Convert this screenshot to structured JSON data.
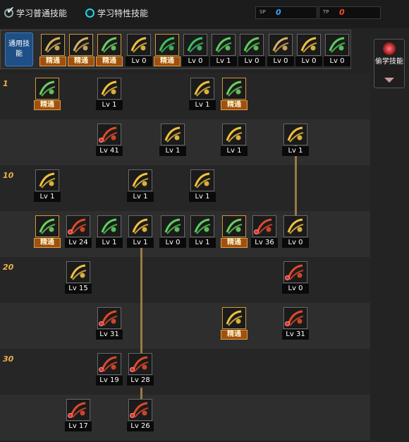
{
  "header": {
    "tab_general": "学习普通技能",
    "tab_special": "学习特性技能",
    "points_sp_label": "SP",
    "points_sp": "0",
    "points_tp_label": "TP",
    "points_tp": "0"
  },
  "general_bar_label": "通用技能",
  "steal_button_label": "偷学技能",
  "level_markers": [
    "1",
    "10",
    "20",
    "30"
  ],
  "general_skills": [
    {
      "level": "精通",
      "mastered": true,
      "color": "#d9b060",
      "icon": "sit-figure-icon"
    },
    {
      "level": "精通",
      "mastered": true,
      "color": "#d9b060",
      "icon": "crouch-figure-icon"
    },
    {
      "level": "精通",
      "mastered": true,
      "color": "#6bd060",
      "icon": "dash-figure-icon"
    },
    {
      "level": "Lv 0",
      "mastered": false,
      "color": "#f0c040",
      "icon": "wings-icon"
    },
    {
      "level": "精通",
      "mastered": true,
      "color": "#40c060",
      "icon": "target-icon"
    },
    {
      "level": "Lv 0",
      "mastered": false,
      "color": "#40c060",
      "icon": "crosshair-icon"
    },
    {
      "level": "Lv 1",
      "mastered": false,
      "color": "#5cd05c",
      "icon": "soldier-icon"
    },
    {
      "level": "Lv 0",
      "mastered": false,
      "color": "#5cd05c",
      "icon": "helmet-icon"
    },
    {
      "level": "Lv 0",
      "mastered": false,
      "color": "#d9b060",
      "icon": "eye-icon"
    },
    {
      "level": "Lv 0",
      "mastered": false,
      "color": "#f0c040",
      "icon": "muscle-icon"
    },
    {
      "level": "Lv 0",
      "mastered": false,
      "color": "#5cd05c",
      "icon": "statue-icon"
    }
  ],
  "tree_skills": [
    {
      "level": "精通",
      "mastered": true,
      "locked": false,
      "color": "#6bd060",
      "icon": "slash-text-icon"
    },
    {
      "level": "Lv 1",
      "mastered": false,
      "locked": false,
      "color": "#f0c040",
      "icon": "wind-slash-icon"
    },
    {
      "level": "Lv 1",
      "mastered": false,
      "locked": false,
      "color": "#f0c040",
      "icon": "arc-slash-icon"
    },
    {
      "level": "精通",
      "mastered": true,
      "locked": false,
      "color": "#6bd060",
      "icon": "flying-figure-icon"
    },
    {
      "level": "Lv 41",
      "mastered": false,
      "locked": true,
      "color": "#e04a2a",
      "icon": "explosion-icon"
    },
    {
      "level": "Lv 1",
      "mastered": false,
      "locked": false,
      "color": "#f0c040",
      "icon": "chevrons-icon"
    },
    {
      "level": "Lv 1",
      "mastered": false,
      "locked": false,
      "color": "#f0c040",
      "icon": "wave-icon"
    },
    {
      "level": "Lv 1",
      "mastered": false,
      "locked": false,
      "color": "#f0c040",
      "icon": "shield-icon"
    },
    {
      "level": "Lv 1",
      "mastered": false,
      "locked": false,
      "color": "#f0c040",
      "icon": "lightning-icon"
    },
    {
      "level": "Lv 1",
      "mastered": false,
      "locked": false,
      "color": "#f0c040",
      "icon": "spiral-icon"
    },
    {
      "level": "Lv 1",
      "mastered": false,
      "locked": false,
      "color": "#f0c040",
      "icon": "dragon-icon"
    },
    {
      "level": "精通",
      "mastered": true,
      "locked": false,
      "color": "#6bd060",
      "icon": "strike-figure-icon"
    },
    {
      "level": "Lv 24",
      "mastered": false,
      "locked": true,
      "color": "#e04a2a",
      "icon": "spear-icon"
    },
    {
      "level": "Lv 1",
      "mastered": false,
      "locked": false,
      "color": "#5cd05c",
      "icon": "blade-icon"
    },
    {
      "level": "Lv 1",
      "mastered": false,
      "locked": false,
      "color": "#f0c040",
      "icon": "cross-blades-icon"
    },
    {
      "level": "Lv 0",
      "mastered": false,
      "locked": false,
      "color": "#5cd05c",
      "icon": "sword-icon"
    },
    {
      "level": "Lv 1",
      "mastered": false,
      "locked": false,
      "color": "#5cd05c",
      "icon": "burst-icon"
    },
    {
      "level": "精通",
      "mastered": true,
      "locked": false,
      "color": "#6bd060",
      "icon": "double-slash-icon"
    },
    {
      "level": "Lv 36",
      "mastered": false,
      "locked": true,
      "color": "#e04a2a",
      "icon": "fire-comet-icon"
    },
    {
      "level": "Lv 0",
      "mastered": false,
      "locked": false,
      "color": "#f0c040",
      "icon": "shield-burst-icon"
    },
    {
      "level": "Lv 15",
      "mastered": false,
      "locked": false,
      "color": "#f0c040",
      "icon": "crescent-icon"
    },
    {
      "level": "Lv 0",
      "mastered": false,
      "locked": true,
      "color": "#e04a2a",
      "icon": "gate-icon"
    },
    {
      "level": "Lv 31",
      "mastered": false,
      "locked": true,
      "color": "#e04a2a",
      "icon": "flame-slash-icon"
    },
    {
      "level": "精通",
      "mastered": true,
      "locked": false,
      "color": "#f0c040",
      "icon": "star-burst-icon"
    },
    {
      "level": "Lv 31",
      "mastered": false,
      "locked": true,
      "color": "#e04a2a",
      "icon": "claw-icon"
    },
    {
      "level": "Lv 19",
      "mastered": false,
      "locked": true,
      "color": "#e04a2a",
      "icon": "meteor-icon"
    },
    {
      "level": "Lv 28",
      "mastered": false,
      "locked": true,
      "color": "#e04a2a",
      "icon": "moon-sword-icon"
    },
    {
      "level": "Lv 17",
      "mastered": false,
      "locked": true,
      "color": "#e04a2a",
      "icon": "ring-icon"
    },
    {
      "level": "Lv 26",
      "mastered": false,
      "locked": true,
      "color": "#e04a2a",
      "icon": "phoenix-icon"
    }
  ]
}
